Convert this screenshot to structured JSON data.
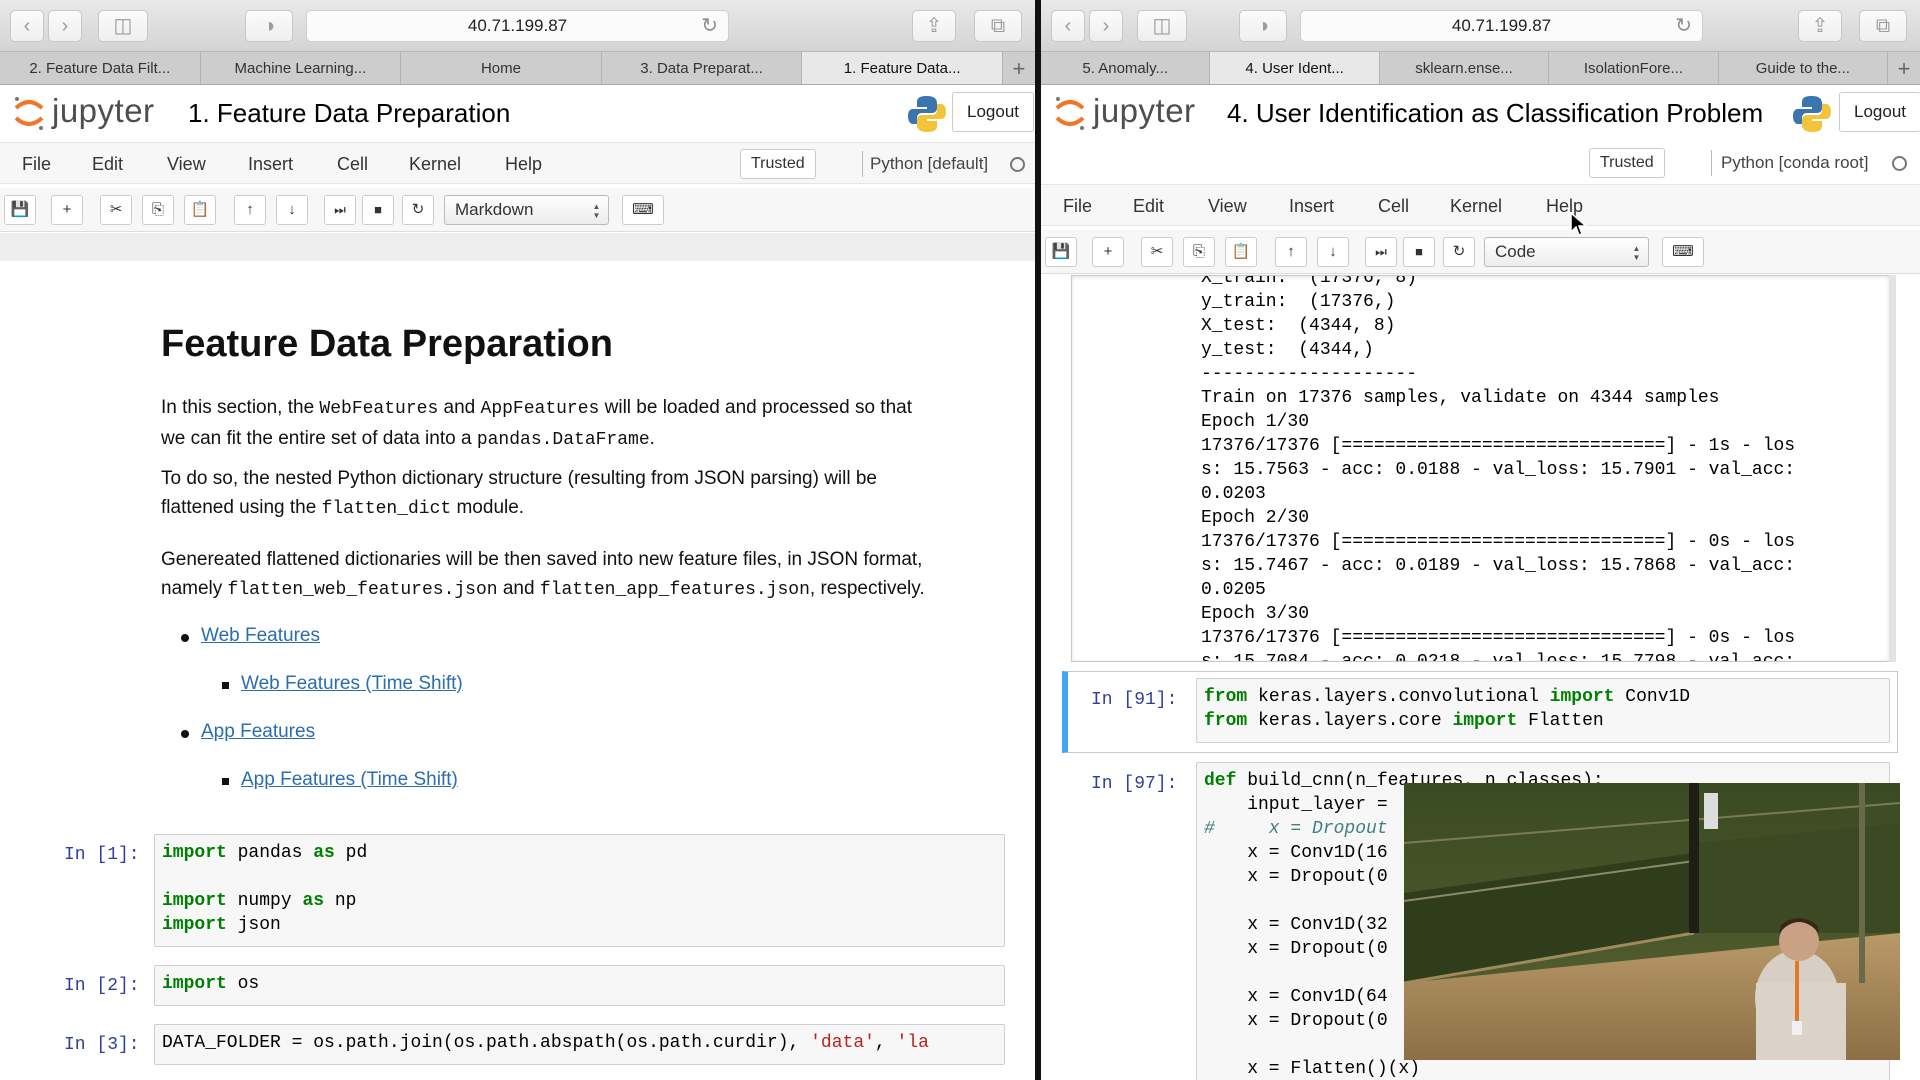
{
  "left": {
    "url": "40.71.199.87",
    "tabs": [
      "2. Feature Data Filt...",
      "Machine Learning...",
      "Home",
      "3. Data Preparat...",
      "1. Feature Data..."
    ],
    "active_tab": 4,
    "logo_text": "jupyter",
    "title": "1. Feature Data Preparation",
    "logout": "Logout",
    "menu": [
      "File",
      "Edit",
      "View",
      "Insert",
      "Cell",
      "Kernel",
      "Help"
    ],
    "trusted": "Trusted",
    "kernel": "Python [default]",
    "cell_type": "Markdown",
    "markdown": {
      "heading": "Feature Data Preparation",
      "p1": {
        "a": "In this section, the ",
        "c1": "WebFeatures",
        "b": " and ",
        "c2": "AppFeatures",
        "c": " will be loaded and processed so that",
        "d": "we can fit the entire set of data into a ",
        "c3": "pandas.DataFrame",
        "e": "."
      },
      "p2": {
        "a": "To do so, the nested Python dictionary structure (resulting from JSON parsing) will be",
        "b": "flattened using the ",
        "c1": "flatten_dict",
        "c": " module."
      },
      "p3": {
        "a": "Genereated flattened dictionaries will be then saved into new feature files, in JSON format,",
        "b": "namely ",
        "c1": "flatten_web_features.json",
        "c": " and ",
        "c2": "flatten_app_features.json",
        "d": ", respectively."
      },
      "links": [
        "Web Features",
        "Web Features (Time Shift)",
        "App Features",
        "App Features (Time Shift)"
      ]
    },
    "cells": [
      {
        "prompt": "In [1]:",
        "lines": [
          [
            {
              "t": "import",
              "c": "kw"
            },
            {
              "t": " pandas "
            },
            {
              "t": "as",
              "c": "kw"
            },
            {
              "t": " pd"
            }
          ],
          [],
          [
            {
              "t": "import",
              "c": "kw"
            },
            {
              "t": " numpy "
            },
            {
              "t": "as",
              "c": "kw"
            },
            {
              "t": " np"
            }
          ],
          [
            {
              "t": "import",
              "c": "kw"
            },
            {
              "t": " json"
            }
          ]
        ]
      },
      {
        "prompt": "In [2]:",
        "lines": [
          [
            {
              "t": "import",
              "c": "kw"
            },
            {
              "t": " os"
            }
          ]
        ]
      },
      {
        "prompt": "In [3]:",
        "lines": [
          [
            {
              "t": "DATA_FOLDER = os.path.join(os.path.abspath(os.path.curdir), "
            },
            {
              "t": "'data'",
              "c": "str"
            },
            {
              "t": ", "
            },
            {
              "t": "'la",
              "c": "str"
            }
          ]
        ]
      }
    ]
  },
  "right": {
    "url": "40.71.199.87",
    "tabs": [
      "5. Anomaly...",
      "4. User Ident...",
      "sklearn.ense...",
      "IsolationFore...",
      "Guide to the..."
    ],
    "active_tab": 1,
    "logo_text": "jupyter",
    "title": "4. User Identification as Classification Problem",
    "logout": "Logout",
    "menu": [
      "File",
      "Edit",
      "View",
      "Insert",
      "Cell",
      "Kernel",
      "Help"
    ],
    "trusted": "Trusted",
    "kernel": "Python [conda root]",
    "cell_type": "Code",
    "output_lines": [
      "X_train:  (17376, 8)",
      "y_train:  (17376,)",
      "X_test:  (4344, 8)",
      "y_test:  (4344,)",
      "--------------------",
      "Train on 17376 samples, validate on 4344 samples",
      "Epoch 1/30",
      "17376/17376 [==============================] - 1s - los",
      "s: 15.7563 - acc: 0.0188 - val_loss: 15.7901 - val_acc:",
      "0.0203",
      "Epoch 2/30",
      "17376/17376 [==============================] - 0s - los",
      "s: 15.7467 - acc: 0.0189 - val_loss: 15.7868 - val_acc:",
      "0.0205",
      "Epoch 3/30",
      "17376/17376 [==============================] - 0s - los",
      "s: 15.7084 - acc: 0.0218 - val_loss: 15.7798 - val_acc:"
    ],
    "cells": [
      {
        "prompt": "In [91]:",
        "lines": [
          [
            {
              "t": "from",
              "c": "kw"
            },
            {
              "t": " keras.layers.convolutional "
            },
            {
              "t": "import",
              "c": "kw"
            },
            {
              "t": " Conv1D"
            }
          ],
          [
            {
              "t": "from",
              "c": "kw"
            },
            {
              "t": " keras.layers.core "
            },
            {
              "t": "import",
              "c": "kw"
            },
            {
              "t": " Flatten"
            }
          ]
        ]
      },
      {
        "prompt": "In [97]:",
        "lines": [
          [
            {
              "t": "def",
              "c": "kw"
            },
            {
              "t": " build_cnn(n_features, n_classes):"
            }
          ],
          [
            {
              "t": "    input_layer = "
            }
          ],
          [
            {
              "t": "#     x = Dropout",
              "c": "cmt"
            }
          ],
          [
            {
              "t": "    x = Conv1D(16"
            }
          ],
          [
            {
              "t": "    x = Dropout(0"
            }
          ],
          [],
          [
            {
              "t": "    x = Conv1D(32"
            }
          ],
          [
            {
              "t": "    x = Dropout(0"
            }
          ],
          [],
          [
            {
              "t": "    x = Conv1D(64"
            }
          ],
          [
            {
              "t": "    x = Dropout(0"
            }
          ],
          [],
          [
            {
              "t": "    x = Flatten()(x)"
            }
          ]
        ]
      }
    ]
  }
}
